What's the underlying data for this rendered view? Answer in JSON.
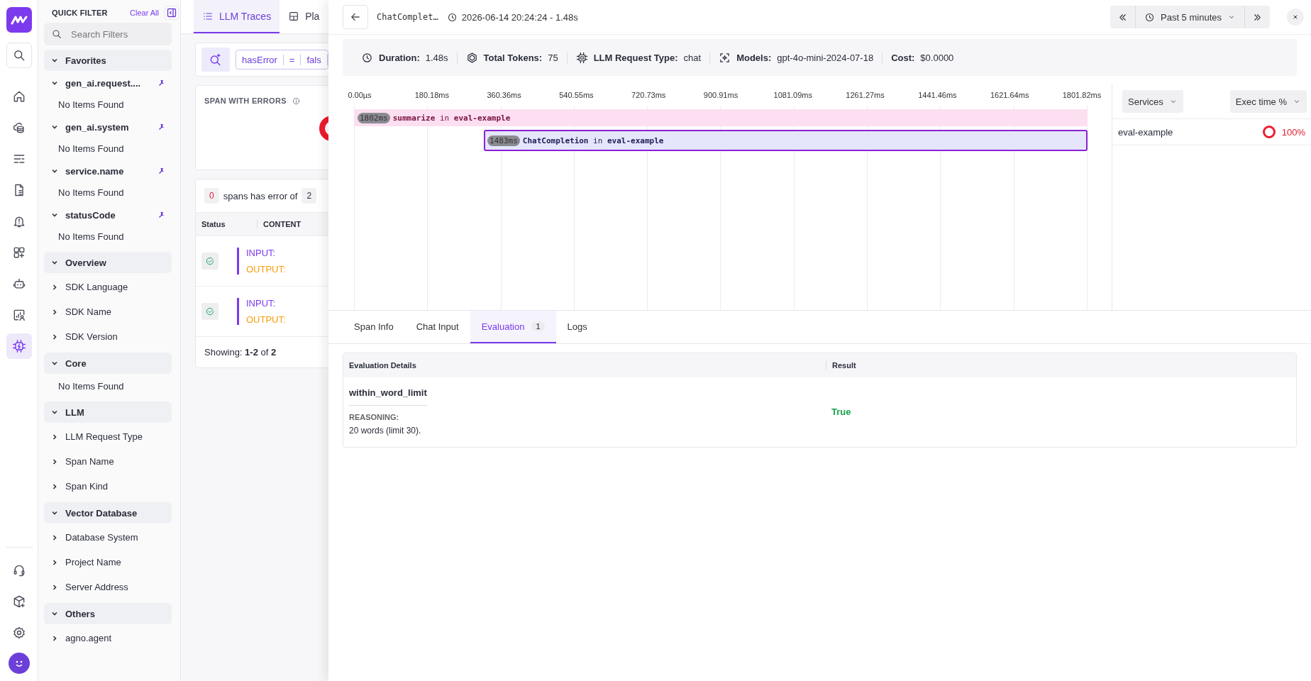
{
  "nav": {
    "items": [
      {
        "selected": false
      },
      {
        "selected": false
      },
      {
        "selected": false
      },
      {
        "selected": false
      },
      {
        "selected": false
      },
      {
        "selected": false
      },
      {
        "selected": false
      },
      {
        "selected": false
      },
      {
        "selected": false
      },
      {
        "selected": true
      }
    ]
  },
  "quick_filter": {
    "title": "QUICK FILTER",
    "clear": "Clear All",
    "search_placeholder": "Search Filters",
    "sections": [
      {
        "title": "Favorites",
        "expanded": true,
        "items": [
          {
            "label": "gen_ai.request....",
            "pinned": true,
            "expanded": true,
            "empty_text": "No Items Found"
          },
          {
            "label": "gen_ai.system",
            "pinned": true,
            "expanded": true,
            "empty_text": "No Items Found"
          },
          {
            "label": "service.name",
            "pinned": true,
            "expanded": true,
            "empty_text": "No Items Found"
          },
          {
            "label": "statusCode",
            "pinned": true,
            "expanded": true,
            "empty_text": "No Items Found"
          }
        ]
      },
      {
        "title": "Overview",
        "expanded": true,
        "items": [
          {
            "label": "SDK Language",
            "pinned": false,
            "expanded": false
          },
          {
            "label": "SDK Name",
            "pinned": false,
            "expanded": false
          },
          {
            "label": "SDK Version",
            "pinned": false,
            "expanded": false
          }
        ]
      },
      {
        "title": "Core",
        "expanded": true,
        "empty_text": "No Items Found"
      },
      {
        "title": "LLM",
        "expanded": true,
        "items": [
          {
            "label": "LLM Request Type",
            "pinned": false,
            "expanded": false
          },
          {
            "label": "Span Name",
            "pinned": false,
            "expanded": false
          },
          {
            "label": "Span Kind",
            "pinned": false,
            "expanded": false
          }
        ]
      },
      {
        "title": "Vector Database",
        "expanded": true,
        "items": [
          {
            "label": "Database System",
            "pinned": false,
            "expanded": false
          },
          {
            "label": "Project Name",
            "pinned": false,
            "expanded": false
          },
          {
            "label": "Server Address",
            "pinned": false,
            "expanded": false
          }
        ]
      },
      {
        "title": "Others",
        "expanded": true,
        "items": [
          {
            "label": "agno.agent",
            "pinned": false,
            "expanded": false
          }
        ]
      }
    ]
  },
  "traces": {
    "tabs": [
      {
        "label": "LLM Traces",
        "selected": true
      },
      {
        "label": "Pla",
        "selected": false
      }
    ],
    "filter": {
      "field": "hasError",
      "operator": "=",
      "value": "fals"
    },
    "errors_card": {
      "title": "SPAN WITH ERRORS"
    },
    "summary": {
      "errors": "0",
      "text": "spans has error of",
      "total": "2"
    },
    "table": {
      "columns": [
        "Status",
        "CONTENT"
      ],
      "rows": [
        {
          "input_label": "INPUT:",
          "output_label": "OUTPUT:"
        },
        {
          "input_label": "INPUT:",
          "output_label": "OUTPUT:"
        }
      ]
    },
    "footer": "Showing: **1-2** of **2**"
  },
  "drawer": {
    "title": "ChatComplet…",
    "timestamp": "2026-06-14 20:24:24 - 1.48s",
    "time_range": "Past 5 minutes",
    "stats": [
      {
        "label": "Duration:",
        "value": "1.48s"
      },
      {
        "label": "Total Tokens:",
        "value": "75"
      },
      {
        "label": "LLM Request Type:",
        "value": "chat"
      },
      {
        "label": "Models:",
        "value": "gpt-4o-mini-2024-07-18"
      },
      {
        "label": "Cost:",
        "value": "$0.0000"
      }
    ],
    "timeline": {
      "ticks": [
        "0.00µs",
        "180.18ms",
        "360.36ms",
        "540.55ms",
        "720.73ms",
        "900.91ms",
        "1081.09ms",
        "1261.27ms",
        "1441.46ms",
        "1621.64ms",
        "1801.82ms"
      ],
      "spans": [
        {
          "duration": "1802ms",
          "label": "**summarize** in **eval-example**",
          "color": "#fcdff0",
          "selected": false
        },
        {
          "duration": "1483ms",
          "label": "**ChatCompletion** in **eval-example**",
          "color": "#e5e6fc",
          "selected": true
        }
      ]
    },
    "services": {
      "group_by": "Services",
      "sort_by": "Exec time %",
      "rows": [
        {
          "name": "eval-example",
          "share": "100%"
        }
      ]
    },
    "detail_tabs": [
      {
        "label": "Span Info",
        "selected": false
      },
      {
        "label": "Chat Input",
        "selected": false
      },
      {
        "label": "Evaluation",
        "badge": "1",
        "selected": true
      },
      {
        "label": "Logs",
        "selected": false
      }
    ],
    "evaluation": {
      "columns": [
        "Evaluation Details",
        "Result"
      ],
      "rows": [
        {
          "name": "within_word_limit",
          "reasoning_label": "REASONING:",
          "reasoning": "20 words (limit 30).",
          "result": "True"
        }
      ]
    }
  }
}
